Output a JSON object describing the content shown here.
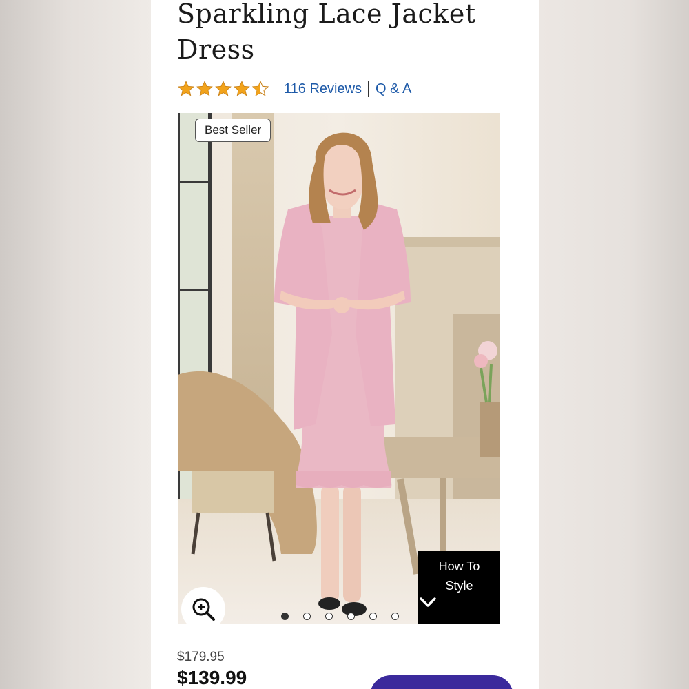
{
  "product": {
    "title": "Sparkling Lace Jacket Dress",
    "rating": 4.5,
    "reviews_label": "116 Reviews",
    "qa_label": "Q & A",
    "badge": "Best Seller",
    "how_to_style": "How To Style",
    "price_original": "$179.95",
    "price_sale": "$139.99"
  },
  "carousel": {
    "count": 6,
    "active_index": 0
  },
  "colors": {
    "star": "#f2a31b",
    "link": "#1e5aa8",
    "cta": "#3b2a9c"
  },
  "icons": {
    "zoom": "zoom-in-icon",
    "chevron": "chevron-down-icon",
    "star": "star-icon"
  }
}
